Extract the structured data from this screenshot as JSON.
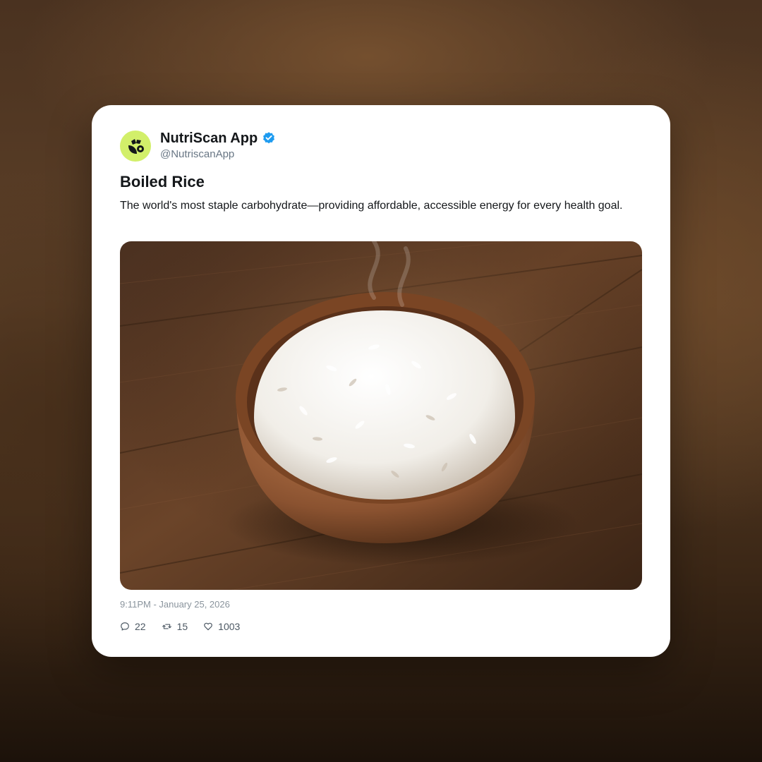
{
  "post": {
    "author": {
      "display_name": "NutriScan App",
      "handle": "@NutriscanApp",
      "verified": true,
      "avatar_color": "#d2ef6a"
    },
    "title": "Boiled Rice",
    "description": "The world's most staple carbohydrate—providing affordable, accessible energy for every health goal.",
    "image_subject": "bowl-of-boiled-rice-photo",
    "timestamp": "9:11PM - January 25, 2026",
    "stats": {
      "replies": "22",
      "reposts": "15",
      "likes": "1003"
    }
  },
  "icons": {
    "verified": "verified-badge-icon",
    "reply": "reply-icon",
    "repost": "repost-icon",
    "like": "like-icon"
  },
  "colors": {
    "verified_blue": "#1d9bf0",
    "text": "#14171a",
    "muted": "#687684"
  }
}
